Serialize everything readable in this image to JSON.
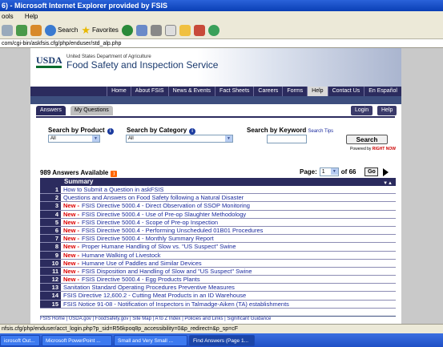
{
  "window": {
    "title": "6) - Microsoft Internet Explorer provided by FSIS"
  },
  "menu": [
    "ools",
    "Help"
  ],
  "toolbar": {
    "search_label": "Search",
    "favorites_label": "Favorites"
  },
  "address": {
    "url": "com/cgi-bin/askfsis.cfg/php/enduser/std_alp.php"
  },
  "header": {
    "dept": "United States Department of Agriculture",
    "agency": "Food Safety and Inspection Service",
    "logo": "USDA"
  },
  "nav": [
    "Home",
    "About FSIS",
    "News & Events",
    "Fact Sheets",
    "Careers",
    "Forms",
    "Help",
    "Contact Us",
    "En Español"
  ],
  "nav_active": "Help",
  "tabs": {
    "answers": "Answers",
    "my_questions": "My Questions",
    "login": "Login",
    "help": "Help"
  },
  "search": {
    "by_product": "Search by Product",
    "by_category": "Search by Category",
    "by_keyword": "Search by Keyword",
    "tips": "Search Tips",
    "product_value": "All",
    "category_value": "All",
    "button": "Search",
    "powered": "Powered by",
    "powered_brand": "RIGHT NOW"
  },
  "results": {
    "count_label": "989 Answers Available",
    "page_label": "Page:",
    "page_value": "1",
    "of_label": "of 66",
    "go": "Go",
    "summary": "Summary"
  },
  "new_label": "New -",
  "rows": [
    {
      "num": "1",
      "new": false,
      "text": "How to Submit a Question in askFSIS"
    },
    {
      "num": "2",
      "new": false,
      "text": "Questions and Answers on Food Safety following a Natural Disaster"
    },
    {
      "num": "3",
      "new": true,
      "text": "FSIS Directive 5000.4 - Direct Observation of SSOP Monitoring"
    },
    {
      "num": "4",
      "new": true,
      "text": "FSIS Directive 5000.4 - Use of Pre-op Slaughter Methodology"
    },
    {
      "num": "5",
      "new": true,
      "text": "FSIS Directive 5000.4 - Scope of Pre-op Inspection"
    },
    {
      "num": "6",
      "new": true,
      "text": "FSIS Directive 5000.4 - Performing Unscheduled 01B01 Procedures"
    },
    {
      "num": "7",
      "new": true,
      "text": "FSIS Directive 5000.4 - Monthly Summary Report"
    },
    {
      "num": "8",
      "new": true,
      "text": "Proper Humane Handling of Slow vs. \"US Suspect\" Swine"
    },
    {
      "num": "9",
      "new": true,
      "text": "Humane Walking of Livestock"
    },
    {
      "num": "10",
      "new": true,
      "text": "Humane Use of Paddles and Similar Devices"
    },
    {
      "num": "11",
      "new": true,
      "text": "FSIS Disposition and Handling of Slow and \"US Suspect\" Swine"
    },
    {
      "num": "12",
      "new": true,
      "text": "FSIS Directive 5000.4 - Egg Products Plants"
    },
    {
      "num": "13",
      "new": false,
      "text": "Sanitation Standard Operating Procedures Preventive Measures"
    },
    {
      "num": "14",
      "new": false,
      "text": "FSIS Directive 12,600.2 - Cutting Meat Products in an ID Warehouse"
    },
    {
      "num": "15",
      "new": false,
      "text": "FSIS Notice 91-08 - Notification of Inspectors in Talmadge-Aiken (TA) establishments"
    }
  ],
  "footer": "FSIS Home | USDA.gov | FoodSafety.gov | Site Map | A to Z Index | Policies and Links | Significant Guidance",
  "status": "nfsis.cfg/php/enduser/acct_login.php?p_sid=R56kpoq8p_accessibility=0&p_redirect=&p_sp=cF",
  "taskbar": [
    "icrosoft Out...",
    "Microsoft PowerPoint ...",
    "Small and Very Small ...",
    "Find Answers (Page 1..."
  ]
}
